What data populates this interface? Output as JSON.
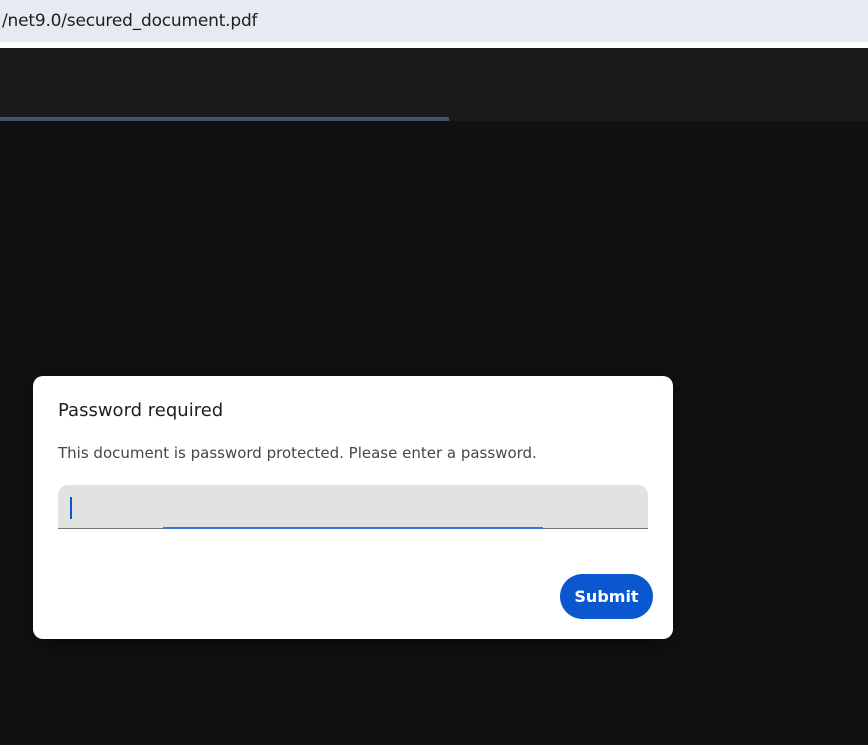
{
  "address_bar": {
    "url": "/net9.0/secured_document.pdf"
  },
  "viewer": {
    "load_progress": 0.517
  },
  "dialog": {
    "title": "Password required",
    "message": "This document is password protected. Please enter a password.",
    "password_value": "",
    "submit_label": "Submit"
  },
  "colors": {
    "accent": "#0b57d0",
    "canvas_bg": "#111111",
    "toolbar_bg": "#1b1b1b",
    "address_bar_bg": "#e8eaf2"
  }
}
